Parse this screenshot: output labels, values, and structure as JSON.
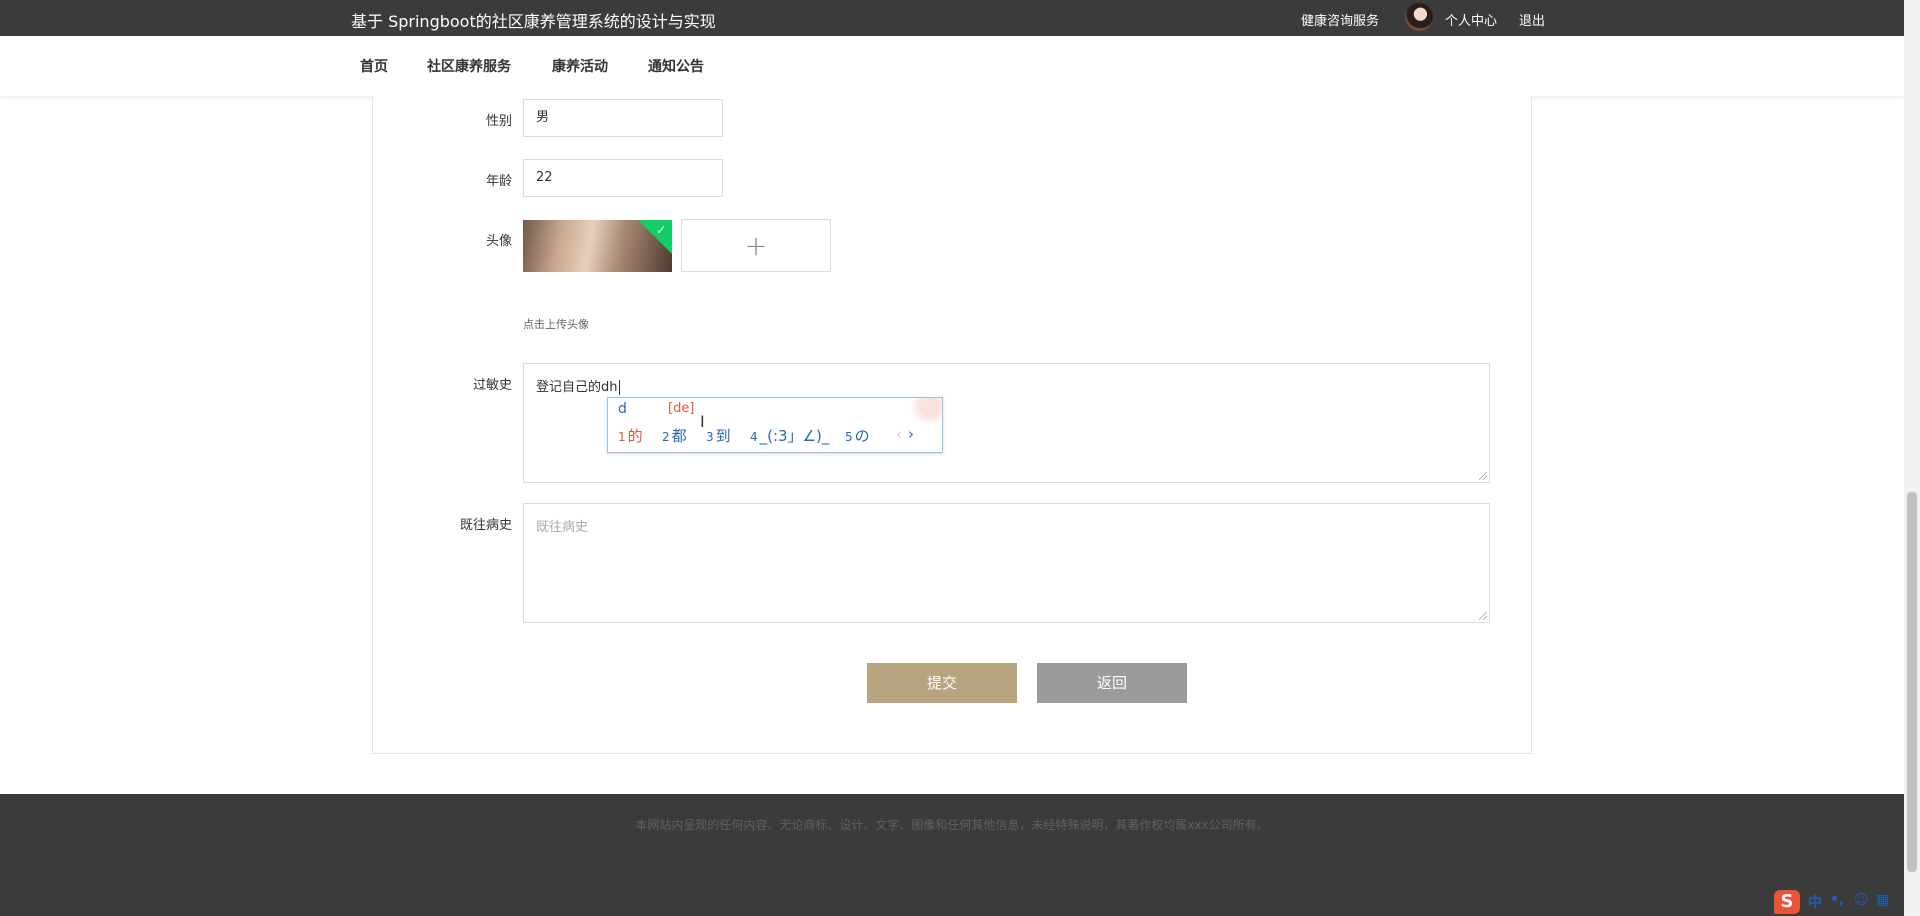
{
  "header": {
    "title": "基于 Springboot的社区康养管理系统的设计与实现",
    "health_consult": "健康咨询服务",
    "personal_center": "个人中心",
    "logout": "退出"
  },
  "nav": {
    "items": [
      "首页",
      "社区康养服务",
      "康养活动",
      "通知公告"
    ]
  },
  "form": {
    "gender_label": "性别",
    "gender_value": "男",
    "age_label": "年龄",
    "age_value": "22",
    "avatar_label": "头像",
    "avatar_hint": "点击上传头像",
    "allergy_label": "过敏史",
    "allergy_value": "登记自己的dh",
    "history_label": "既往病史",
    "history_placeholder": "既往病史",
    "submit_label": "提交",
    "back_label": "返回"
  },
  "ime": {
    "composition": "d",
    "pinyin": "[de]",
    "candidates": [
      {
        "num": "1",
        "text": "的"
      },
      {
        "num": "2",
        "text": "都"
      },
      {
        "num": "3",
        "text": "到"
      },
      {
        "num": "4",
        "text": "_(:3」∠)_"
      },
      {
        "num": "5",
        "text": "の"
      }
    ],
    "prev": "‹",
    "next": "›"
  },
  "footer": {
    "copyright": "本网站内呈现的任何内容、无论商标、设计、文字、图像和任何其他信息，未经特殊说明，其著作权均属xxx公司所有。"
  },
  "tray": {
    "lang": "中",
    "punct": "•,"
  }
}
